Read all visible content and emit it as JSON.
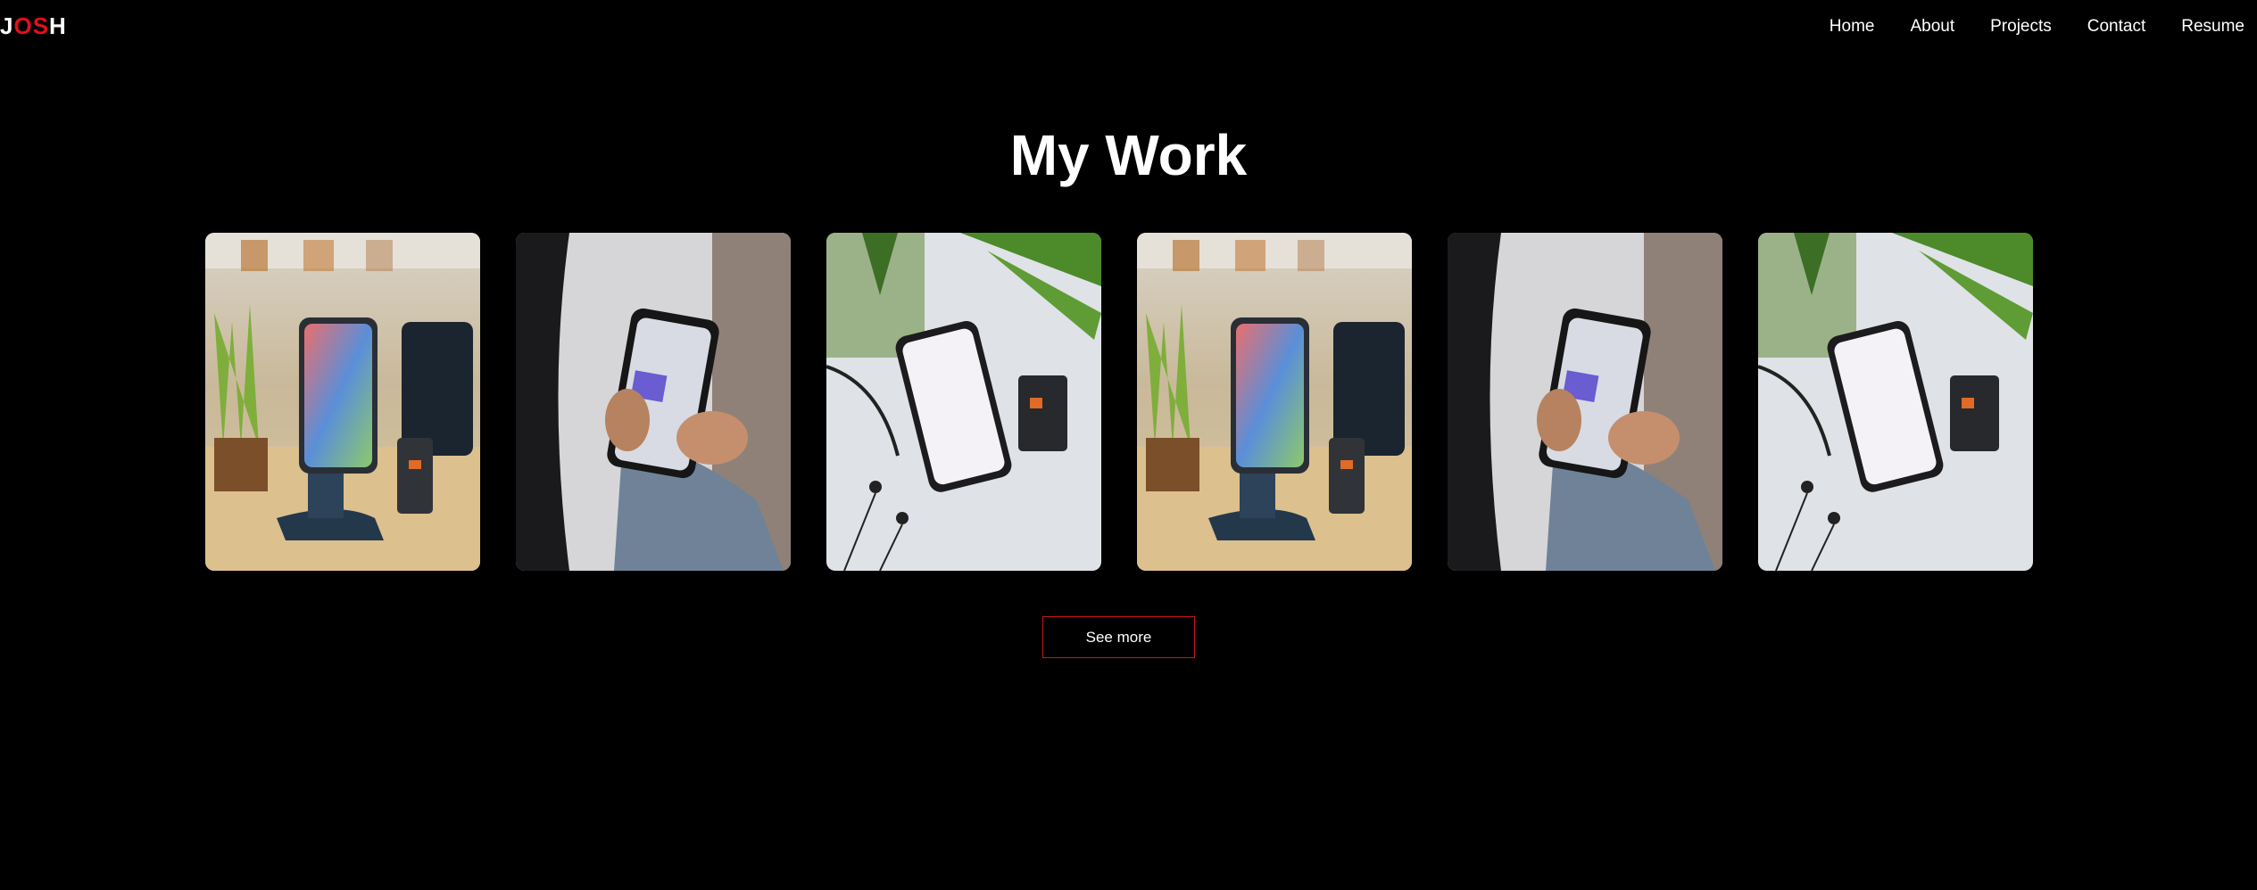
{
  "header": {
    "logo_left": "J",
    "logo_mid": "OS",
    "logo_right": "H"
  },
  "nav": {
    "items": [
      {
        "label": "Home"
      },
      {
        "label": "About"
      },
      {
        "label": "Projects"
      },
      {
        "label": "Contact"
      },
      {
        "label": "Resume"
      }
    ]
  },
  "main": {
    "title": "My Work",
    "see_more_label": "See more",
    "projects": [
      {
        "image": "phone-on-stand-photo"
      },
      {
        "image": "hand-holding-phone-photo"
      },
      {
        "image": "phone-on-table-photo"
      },
      {
        "image": "phone-on-stand-photo"
      },
      {
        "image": "hand-holding-phone-photo"
      },
      {
        "image": "phone-on-table-photo"
      }
    ]
  },
  "colors": {
    "background": "#000000",
    "text": "#ffffff",
    "accent": "#c8141c"
  }
}
